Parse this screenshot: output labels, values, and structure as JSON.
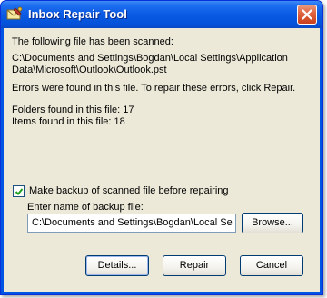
{
  "window": {
    "title": "Inbox Repair Tool",
    "icon": "envelope-repair-icon",
    "close_icon": "close-icon"
  },
  "content": {
    "scanned_heading": "The following file has been scanned:",
    "file_path_line1": "C:\\Documents and Settings\\Bogdan\\Local Settings\\Application",
    "file_path_line2": "Data\\Microsoft\\Outlook\\Outlook.pst",
    "errors_message": "Errors were found in this file. To repair these errors, click Repair.",
    "folders_found": "Folders found in this file: 17",
    "items_found": "Items found in this file: 18"
  },
  "backup": {
    "checkbox_label": "Make backup of scanned file before repairing",
    "checked": true,
    "input_label": "Enter name of backup file:",
    "input_value": "C:\\Documents and Settings\\Bogdan\\Local Se",
    "browse_label": "Browse..."
  },
  "buttons": {
    "details": "Details...",
    "repair": "Repair",
    "cancel": "Cancel"
  },
  "colors": {
    "titlebar": "#0a5ae4",
    "client_bg": "#ece9d8",
    "close_button": "#e16542"
  }
}
